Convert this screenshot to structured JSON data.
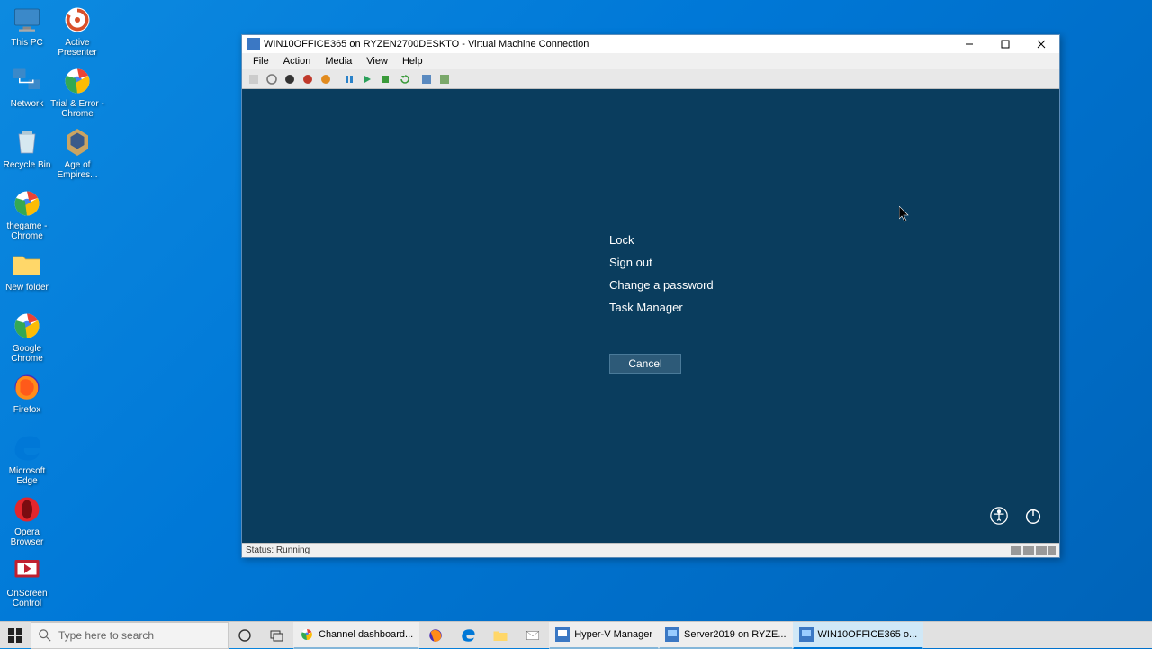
{
  "desktop": {
    "icons": [
      {
        "label": "This PC"
      },
      {
        "label": "Active Presenter"
      },
      {
        "label": "Network"
      },
      {
        "label": "Trial & Error - Chrome"
      },
      {
        "label": "Recycle Bin"
      },
      {
        "label": "Age of Empires..."
      },
      {
        "label": "thegame - Chrome"
      },
      {
        "label": "New folder"
      },
      {
        "label": "Google Chrome"
      },
      {
        "label": "Firefox"
      },
      {
        "label": "Microsoft Edge"
      },
      {
        "label": "Opera Browser"
      },
      {
        "label": "OnScreen Control"
      }
    ]
  },
  "taskbar": {
    "search_placeholder": "Type here to search",
    "apps": [
      {
        "label": "Channel dashboard..."
      },
      {
        "label": "Hyper-V Manager"
      },
      {
        "label": "Server2019 on RYZE..."
      },
      {
        "label": "WIN10OFFICE365 o..."
      }
    ]
  },
  "vm": {
    "title": "WIN10OFFICE365 on RYZEN2700DESKTO - Virtual Machine Connection",
    "menus": [
      "File",
      "Action",
      "Media",
      "View",
      "Help"
    ],
    "security_options": [
      "Lock",
      "Sign out",
      "Change a password",
      "Task Manager"
    ],
    "cancel_label": "Cancel",
    "status": "Status: Running"
  }
}
